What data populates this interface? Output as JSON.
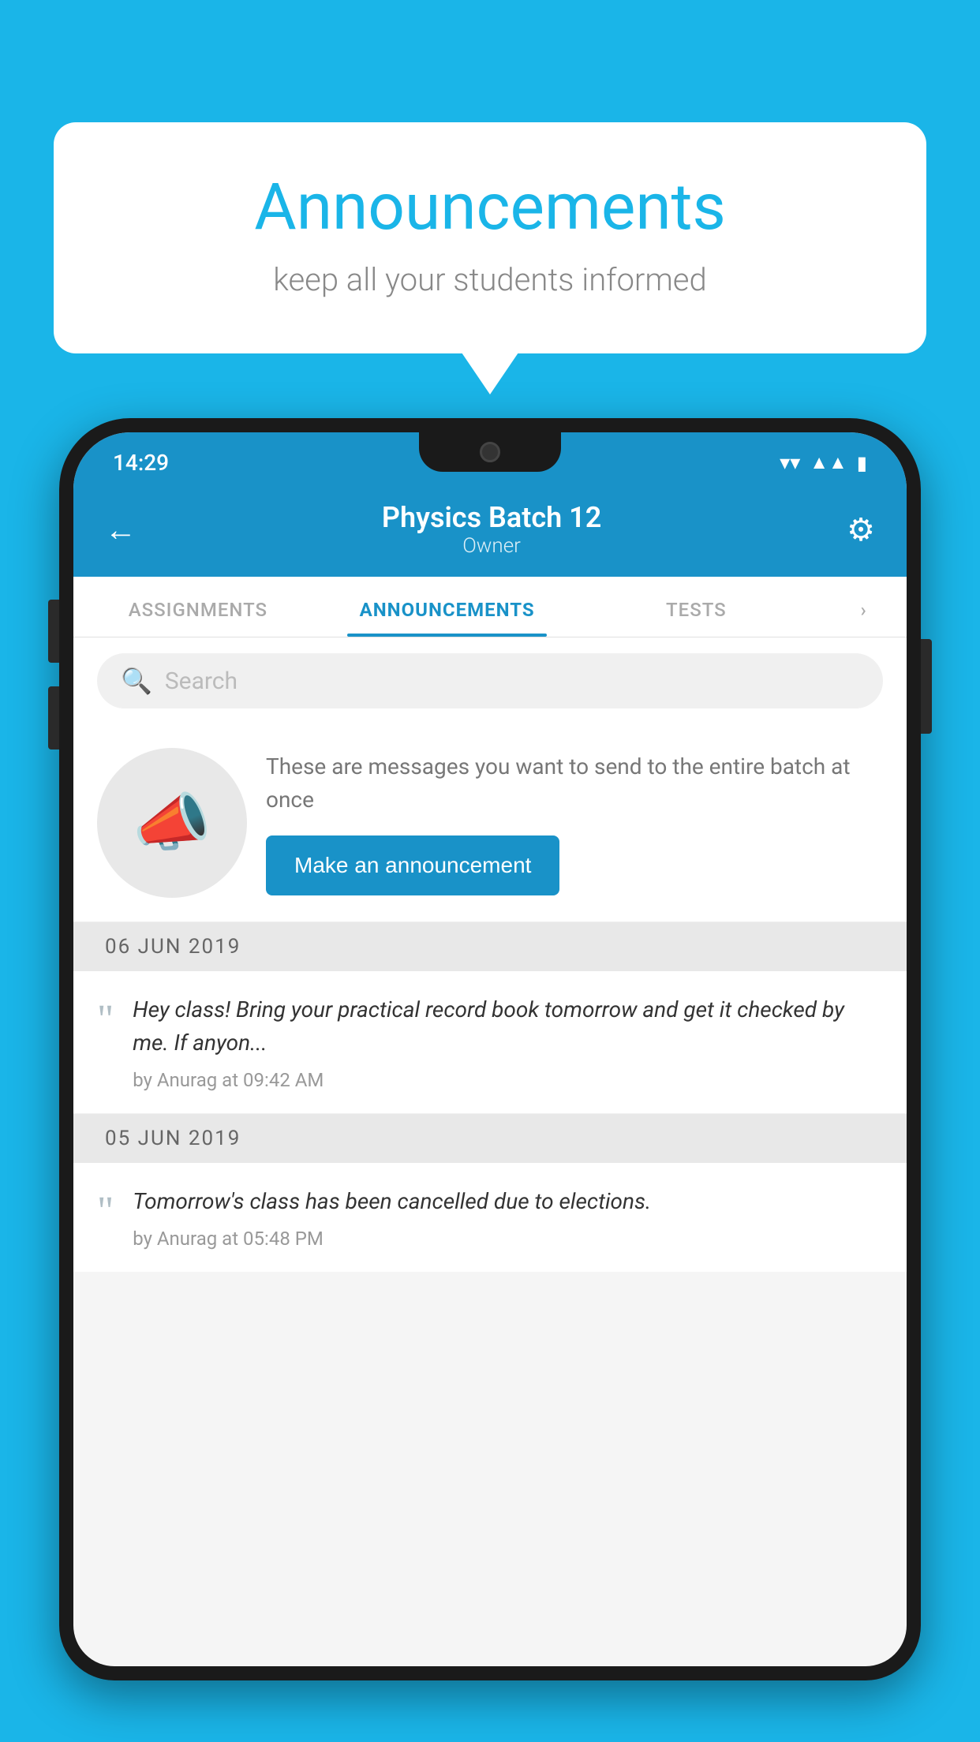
{
  "background_color": "#1ab5e8",
  "speech_bubble": {
    "title": "Announcements",
    "subtitle": "keep all your students informed"
  },
  "phone": {
    "status_bar": {
      "time": "14:29",
      "wifi": "▼",
      "signal": "▲",
      "battery": "▮"
    },
    "header": {
      "back_label": "←",
      "title": "Physics Batch 12",
      "subtitle": "Owner",
      "gear_label": "⚙"
    },
    "tabs": [
      {
        "label": "ASSIGNMENTS",
        "active": false
      },
      {
        "label": "ANNOUNCEMENTS",
        "active": true
      },
      {
        "label": "TESTS",
        "active": false
      },
      {
        "label": "›",
        "active": false
      }
    ],
    "search": {
      "placeholder": "Search",
      "icon": "🔍"
    },
    "promo": {
      "description": "These are messages you want to send to the entire batch at once",
      "button_label": "Make an announcement"
    },
    "announcements": [
      {
        "date": "06  JUN  2019",
        "text": "Hey class! Bring your practical record book tomorrow and get it checked by me. If anyon...",
        "meta": "by Anurag at 09:42 AM"
      },
      {
        "date": "05  JUN  2019",
        "text": "Tomorrow's class has been cancelled due to elections.",
        "meta": "by Anurag at 05:48 PM"
      }
    ]
  }
}
